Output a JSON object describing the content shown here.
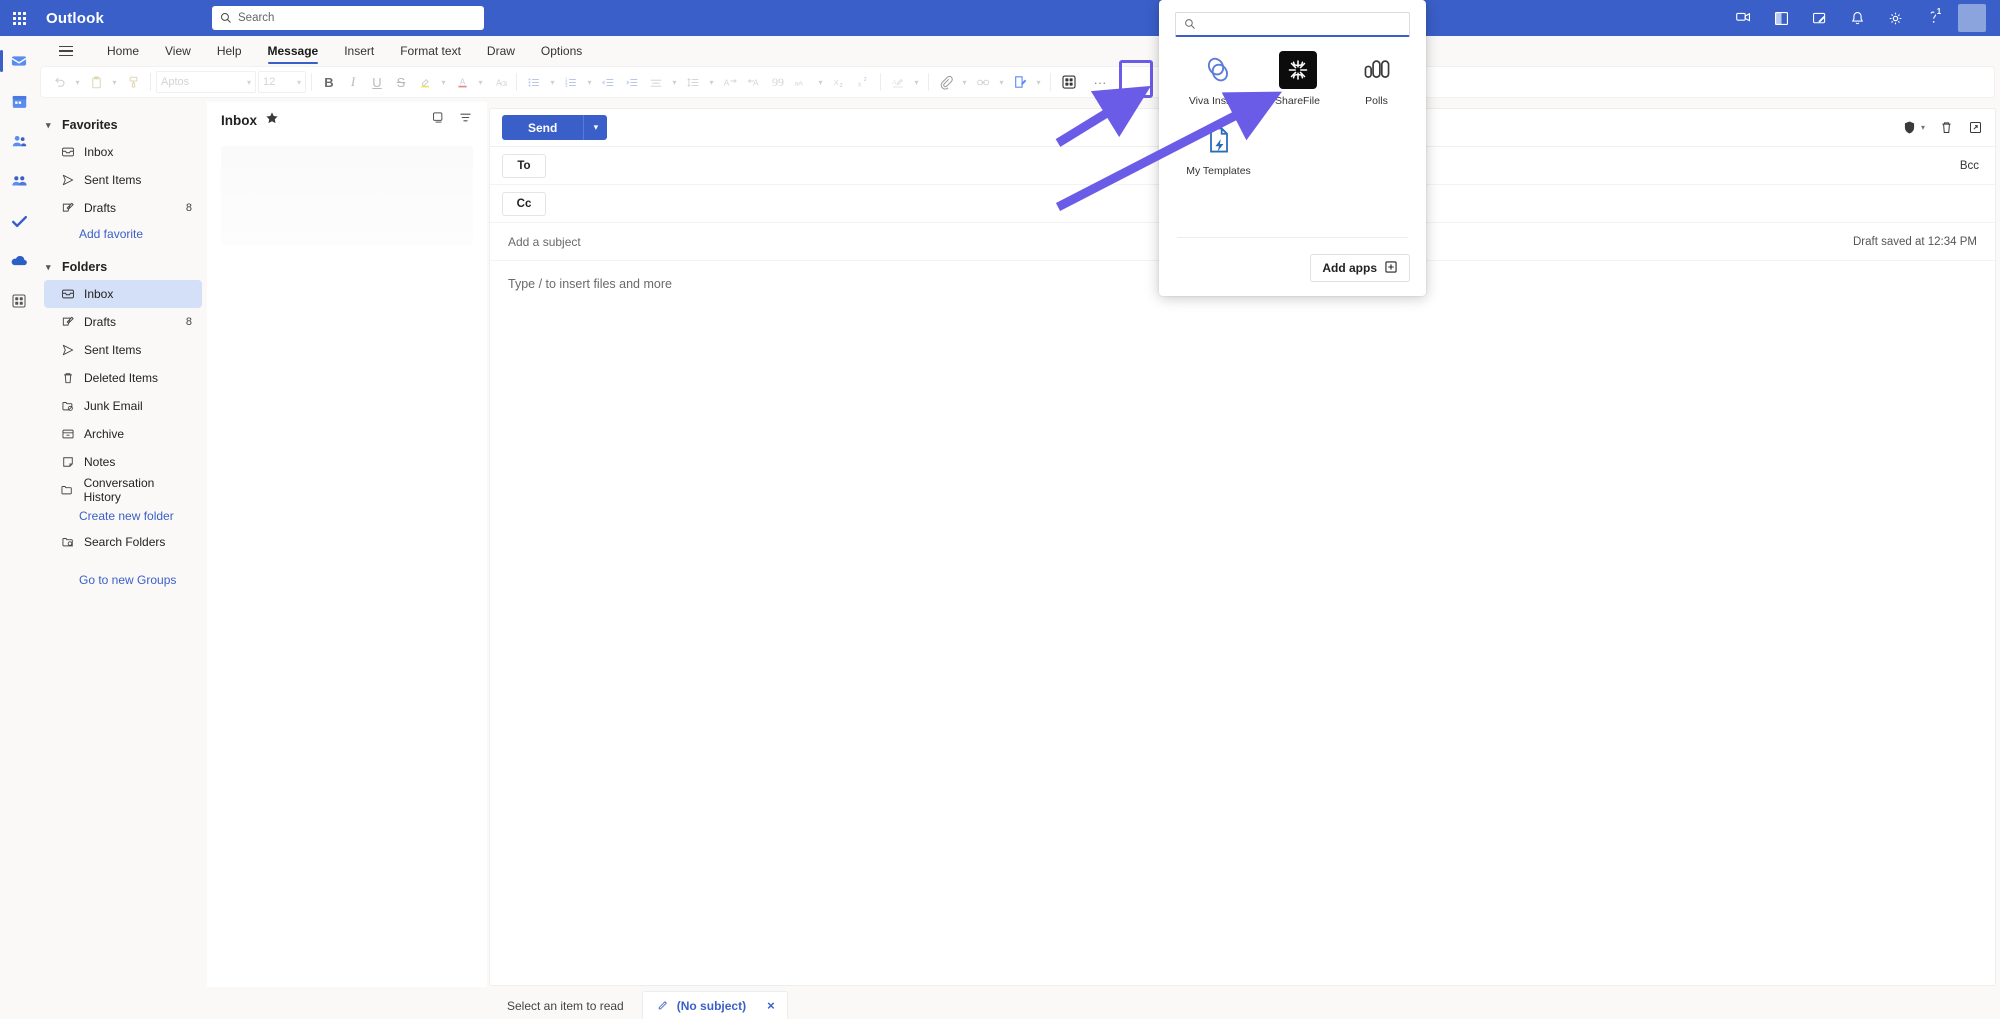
{
  "topbar": {
    "brand": "Outlook",
    "waffle_icon": "app-launcher-icon",
    "search": {
      "placeholder": "Search",
      "value": "",
      "icon": "search-icon"
    },
    "icons": [
      {
        "name": "meet-now-icon",
        "glyph": "chat"
      },
      {
        "name": "office-apps-icon",
        "glyph": "office"
      },
      {
        "name": "feedback-icon",
        "glyph": "note-edit"
      },
      {
        "name": "notifications-icon",
        "glyph": "bell"
      },
      {
        "name": "settings-icon",
        "glyph": "gear"
      },
      {
        "name": "diagnostics-icon",
        "glyph": "badge",
        "badge": "1"
      }
    ],
    "avatar": "avatar"
  },
  "rail": {
    "items": [
      {
        "name": "rail-mail",
        "label": "Mail",
        "active": true
      },
      {
        "name": "rail-calendar",
        "label": "Calendar",
        "active": false
      },
      {
        "name": "rail-people",
        "label": "People",
        "active": false
      },
      {
        "name": "rail-groups",
        "label": "Groups",
        "active": false
      },
      {
        "name": "rail-todo",
        "label": "To Do",
        "active": false
      },
      {
        "name": "rail-onedrive",
        "label": "OneDrive",
        "active": false
      },
      {
        "name": "rail-apps",
        "label": "Apps",
        "active": false
      }
    ]
  },
  "ribbon": {
    "tabs": [
      {
        "label": "Home",
        "active": false
      },
      {
        "label": "View",
        "active": false
      },
      {
        "label": "Help",
        "active": false
      },
      {
        "label": "Message",
        "active": true
      },
      {
        "label": "Insert",
        "active": false
      },
      {
        "label": "Format text",
        "active": false
      },
      {
        "label": "Draw",
        "active": false
      },
      {
        "label": "Options",
        "active": false
      }
    ],
    "font_name": "Aptos",
    "font_size": "12",
    "overflow_label": "···"
  },
  "list_pane": {
    "title": "Inbox",
    "favorite_icon": "star-filled-icon",
    "actions": [
      {
        "name": "conversation-view-icon"
      },
      {
        "name": "filter-icon"
      }
    ]
  },
  "sidebar": {
    "favorites": {
      "label": "Favorites",
      "items": [
        {
          "label": "Inbox",
          "icon": "inbox-icon",
          "count": ""
        },
        {
          "label": "Sent Items",
          "icon": "send-icon",
          "count": ""
        },
        {
          "label": "Drafts",
          "icon": "draft-pencil-icon",
          "count": "8"
        }
      ],
      "add_link": "Add favorite"
    },
    "folders": {
      "label": "Folders",
      "items": [
        {
          "label": "Inbox",
          "icon": "inbox-icon",
          "count": "",
          "selected": true
        },
        {
          "label": "Drafts",
          "icon": "draft-pencil-icon",
          "count": "8",
          "selected": false
        },
        {
          "label": "Sent Items",
          "icon": "send-icon",
          "count": "",
          "selected": false
        },
        {
          "label": "Deleted Items",
          "icon": "trash-icon",
          "count": "",
          "selected": false
        },
        {
          "label": "Junk Email",
          "icon": "junk-folder-icon",
          "count": "",
          "selected": false
        },
        {
          "label": "Archive",
          "icon": "archive-icon",
          "count": "",
          "selected": false
        },
        {
          "label": "Notes",
          "icon": "notes-icon",
          "count": "",
          "selected": false
        },
        {
          "label": "Conversation History",
          "icon": "folder-icon",
          "count": "",
          "selected": false
        }
      ],
      "create_link": "Create new folder",
      "search_folders": {
        "label": "Search Folders",
        "icon": "search-folder-icon"
      },
      "groups_link": "Go to new Groups"
    }
  },
  "compose": {
    "send_label": "Send",
    "send_chevron": "chevron-down-icon",
    "top_icons": [
      {
        "name": "encrypt-icon"
      },
      {
        "name": "discard-icon"
      },
      {
        "name": "popout-icon"
      }
    ],
    "to_label": "To",
    "cc_label": "Cc",
    "bcc_label": "Bcc",
    "subject_placeholder": "Add a subject",
    "draft_status": "Draft saved at 12:34 PM",
    "body_placeholder": "Type / to insert files and more"
  },
  "bottom": {
    "reading_hint": "Select an item to read",
    "draft_tab": {
      "label": "(No subject)",
      "icon": "pencil-icon",
      "close": "×"
    }
  },
  "flyout": {
    "search": {
      "placeholder": "",
      "value": "",
      "icon": "search-icon"
    },
    "apps": [
      {
        "label": "Viva Insights",
        "icon": "viva-insights-icon"
      },
      {
        "label": "ShareFile",
        "icon": "sharefile-icon"
      },
      {
        "label": "Polls",
        "icon": "polls-icon"
      },
      {
        "label": "My Templates",
        "icon": "my-templates-icon"
      }
    ],
    "add_apps_label": "Add apps",
    "add_apps_icon": "add-box-icon"
  },
  "colors": {
    "brand_blue": "#3a5fc8",
    "annotation_purple": "#6b5ce7",
    "selection_blue": "#d3e0f7"
  }
}
